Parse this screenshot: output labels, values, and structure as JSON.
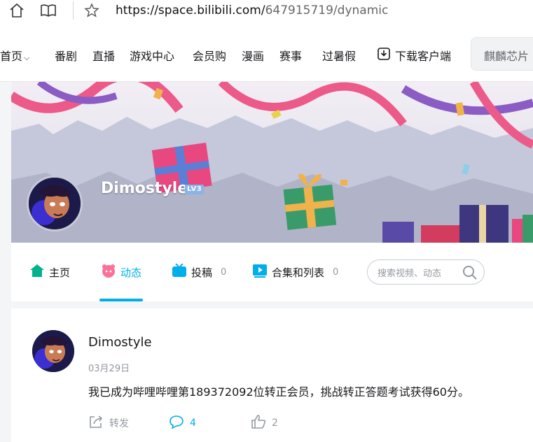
{
  "browser": {
    "url_host": "https://space.bilibili.com/",
    "url_path": "647915719/dynamic",
    "icons": {
      "home": "home-icon",
      "reader": "reader-icon",
      "favorite": "star-icon"
    }
  },
  "site_nav": {
    "items": [
      "首页",
      "番剧",
      "直播",
      "游戏中心",
      "会员购",
      "漫画",
      "赛事",
      "过暑假"
    ],
    "download": "下载客户端",
    "search_placeholder": "麒麟芯片"
  },
  "profile": {
    "name": "Dimostyle",
    "level": "LV3"
  },
  "tabs": [
    {
      "label": "主页",
      "count": "",
      "color": "#00b38a"
    },
    {
      "label": "动态",
      "count": "",
      "color": "#fb7299",
      "active": true
    },
    {
      "label": "投稿",
      "count": "0",
      "color": "#00aeec"
    },
    {
      "label": "合集和列表",
      "count": "0",
      "color": "#00aeec"
    }
  ],
  "profile_search": {
    "placeholder": "搜索视频、动态"
  },
  "post": {
    "author": "Dimostyle",
    "date": "03月29日",
    "content": "我已成为哔哩哔哩第189372092位转正会员，挑战转正答题考试获得60分。",
    "actions": {
      "repost_label": "转发",
      "comment_count": "4",
      "like_count": "2"
    }
  },
  "colors": {
    "accent": "#00aeec",
    "pink": "#fb7299",
    "text_muted": "#9499a0"
  }
}
